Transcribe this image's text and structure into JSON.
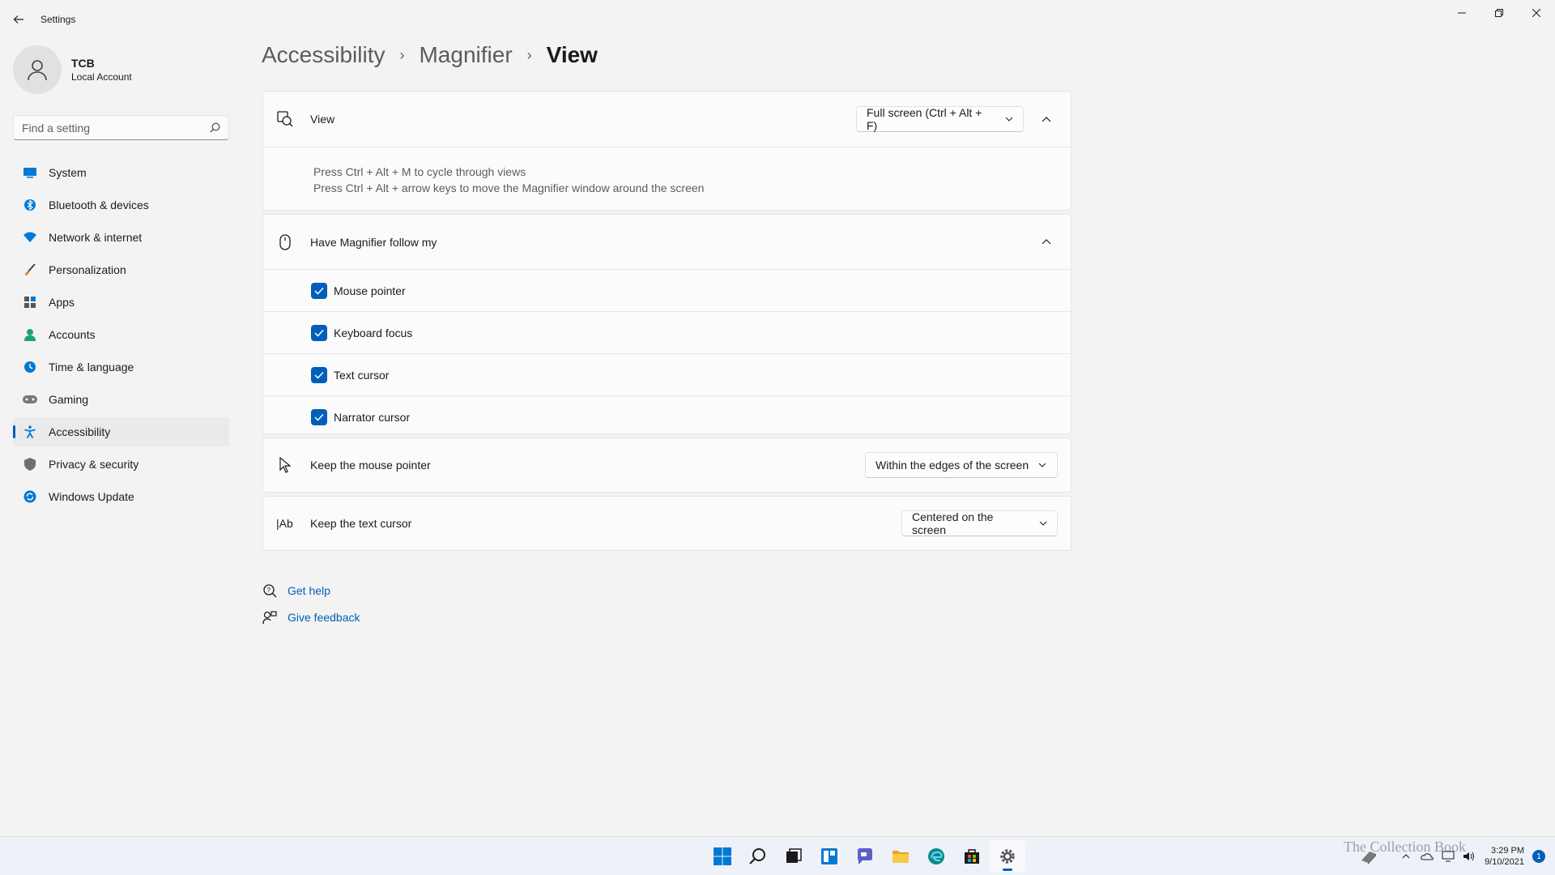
{
  "window": {
    "app_title": "Settings"
  },
  "profile": {
    "name": "TCB",
    "account_type": "Local Account"
  },
  "search": {
    "placeholder": "Find a setting"
  },
  "sidebar": {
    "items": [
      {
        "label": "System",
        "icon": "system-icon",
        "color": "#0078d4"
      },
      {
        "label": "Bluetooth & devices",
        "icon": "bluetooth-icon",
        "color": "#0078d4"
      },
      {
        "label": "Network & internet",
        "icon": "wifi-icon",
        "color": "#0078d4"
      },
      {
        "label": "Personalization",
        "icon": "brush-icon",
        "color": "#e08a2c"
      },
      {
        "label": "Apps",
        "icon": "apps-icon",
        "color": "#555555"
      },
      {
        "label": "Accounts",
        "icon": "accounts-icon",
        "color": "#1aa37a"
      },
      {
        "label": "Time & language",
        "icon": "globe-clock-icon",
        "color": "#0078d4"
      },
      {
        "label": "Gaming",
        "icon": "gamepad-icon",
        "color": "#777777"
      },
      {
        "label": "Accessibility",
        "icon": "accessibility-icon",
        "color": "#0078d4",
        "active": true
      },
      {
        "label": "Privacy & security",
        "icon": "shield-icon",
        "color": "#6e6e6e"
      },
      {
        "label": "Windows Update",
        "icon": "update-icon",
        "color": "#0078d4"
      }
    ]
  },
  "breadcrumb": {
    "level1": "Accessibility",
    "level2": "Magnifier",
    "current": "View",
    "separator": "›"
  },
  "view_card": {
    "title": "View",
    "dropdown_value": "Full screen (Ctrl + Alt + F)",
    "hint_line1": "Press Ctrl + Alt + M to cycle through views",
    "hint_line2": "Press Ctrl + Alt + arrow keys to move the Magnifier window around the screen"
  },
  "follow_card": {
    "title": "Have Magnifier follow my",
    "options": [
      {
        "label": "Mouse pointer",
        "checked": true
      },
      {
        "label": "Keyboard focus",
        "checked": true
      },
      {
        "label": "Text cursor",
        "checked": true
      },
      {
        "label": "Narrator cursor",
        "checked": true
      }
    ]
  },
  "mouse_card": {
    "title": "Keep the mouse pointer",
    "dropdown_value": "Within the edges of the screen"
  },
  "text_card": {
    "title": "Keep the text cursor",
    "icon_text": "|Ab",
    "dropdown_value": "Centered on the screen"
  },
  "links": {
    "help": "Get help",
    "feedback": "Give feedback"
  },
  "taskbar": {
    "apps": [
      "start-icon",
      "search-icon",
      "task-view-icon",
      "widgets-icon",
      "chat-icon",
      "file-explorer-icon",
      "edge-icon",
      "store-icon",
      "settings-icon"
    ],
    "time": "3:29 PM",
    "date": "9/10/2021",
    "notification_count": "1",
    "watermark": "The Collection Book"
  },
  "colors": {
    "accent": "#005fb8",
    "background": "#f3f3f3",
    "card": "#fbfbfb"
  }
}
